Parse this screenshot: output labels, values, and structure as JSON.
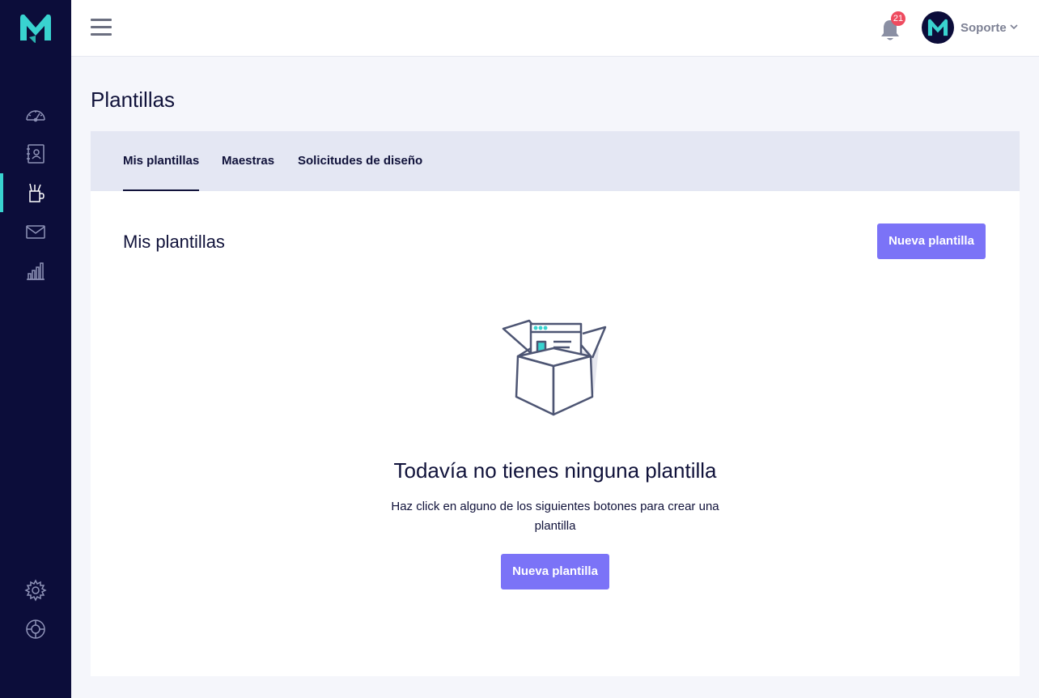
{
  "app": {
    "brand_color": "#39d3d0",
    "sidebar_color": "#0c0d3a",
    "accent_color": "#7b73f7"
  },
  "sidebar": {
    "items": [
      {
        "icon": "speedometer-icon",
        "active": false
      },
      {
        "icon": "contacts-book-icon",
        "active": false
      },
      {
        "icon": "templates-icon",
        "active": true
      },
      {
        "icon": "envelope-icon",
        "active": false
      },
      {
        "icon": "bar-chart-icon",
        "active": false
      }
    ],
    "bottom_items": [
      {
        "icon": "gear-icon"
      },
      {
        "icon": "lifebuoy-icon"
      }
    ]
  },
  "header": {
    "notifications_count": "21",
    "user_name": "Soporte"
  },
  "page": {
    "title": "Plantillas",
    "tabs": [
      {
        "label": "Mis plantillas",
        "active": true
      },
      {
        "label": "Maestras",
        "active": false
      },
      {
        "label": "Solicitudes de diseño",
        "active": false
      }
    ]
  },
  "content": {
    "section_title": "Mis plantillas",
    "new_button_label": "Nueva plantilla",
    "empty_state": {
      "icon": "empty-box-icon",
      "title": "Todavía no tienes ninguna plantilla",
      "description": "Haz click en alguno de los siguientes botones para crear una plantilla",
      "button_label": "Nueva plantilla"
    }
  }
}
